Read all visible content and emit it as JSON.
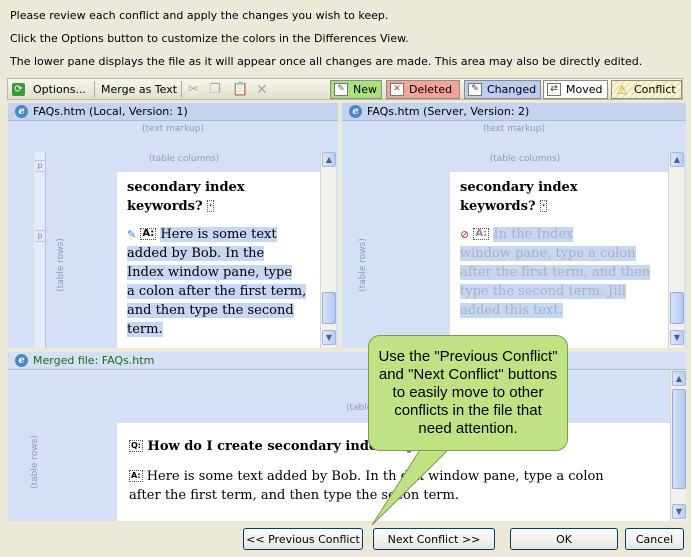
{
  "instructions": [
    "Please review each conflict and apply the changes you wish to keep.",
    "Click the Options button to customize the colors in the Differences View.",
    "The lower pane displays the file as it will appear once all changes are made. This area may also be directly edited."
  ],
  "toolbar": {
    "options_label": "Options...",
    "merge_label": "Merge as Text",
    "legend": {
      "new": "New",
      "deleted": "Deleted",
      "changed": "Changed",
      "moved": "Moved",
      "conflict": "Conflict"
    },
    "colors": {
      "new": "#a9e27d",
      "deleted": "#f4a39b",
      "changed": "#b9cdf2",
      "moved": "#ffffff",
      "conflict": "#fff6c9"
    }
  },
  "left_pane": {
    "title": "FAQs.htm (Local, Version: 1)",
    "markup_label": "(text markup)",
    "columns_label": "(table columns)",
    "rows_label": "(table rows)",
    "ruler_tags": [
      "p",
      "p"
    ],
    "heading_lines": [
      "secondary index",
      "keywords?"
    ],
    "tag": "A:",
    "body_lines": [
      "Here is some text",
      "added by Bob. In the",
      "Index window pane, type",
      "a colon after the first term,",
      "and then type the second",
      "term."
    ]
  },
  "right_pane": {
    "title": "FAQs.htm (Server, Version: 2)",
    "markup_label": "(text markup)",
    "columns_label": "(table columns)",
    "rows_label": "(table rows)",
    "heading_lines": [
      "secondary index",
      "keywords?"
    ],
    "tag": "A:",
    "body_lines": [
      "In the Index",
      "window pane, type a colon",
      "after the first term, and then",
      "type the second term. Jill",
      "added this text."
    ]
  },
  "merged_pane": {
    "title": "Merged file: FAQs.htm",
    "columns_label": "(table c",
    "rows_label": "(table rows)",
    "q_tag": "Q:",
    "question": "How do I create secondary index keywo",
    "a_tag": "A:",
    "answer_line1": "Here is some text added by Bob. In th",
    "answer_line1_end": "dex window pane, type a colon",
    "answer_line2": "after the first term, and then type the secon",
    "answer_line2_end": "term."
  },
  "callout": {
    "text": "Use the \"Previous Conflict\" and \"Next Conflict\" buttons to easily move to other conflicts in the file that need attention."
  },
  "buttons": {
    "previous": "<< Previous Conflict",
    "next": "Next Conflict >>",
    "ok": "OK",
    "cancel": "Cancel"
  }
}
